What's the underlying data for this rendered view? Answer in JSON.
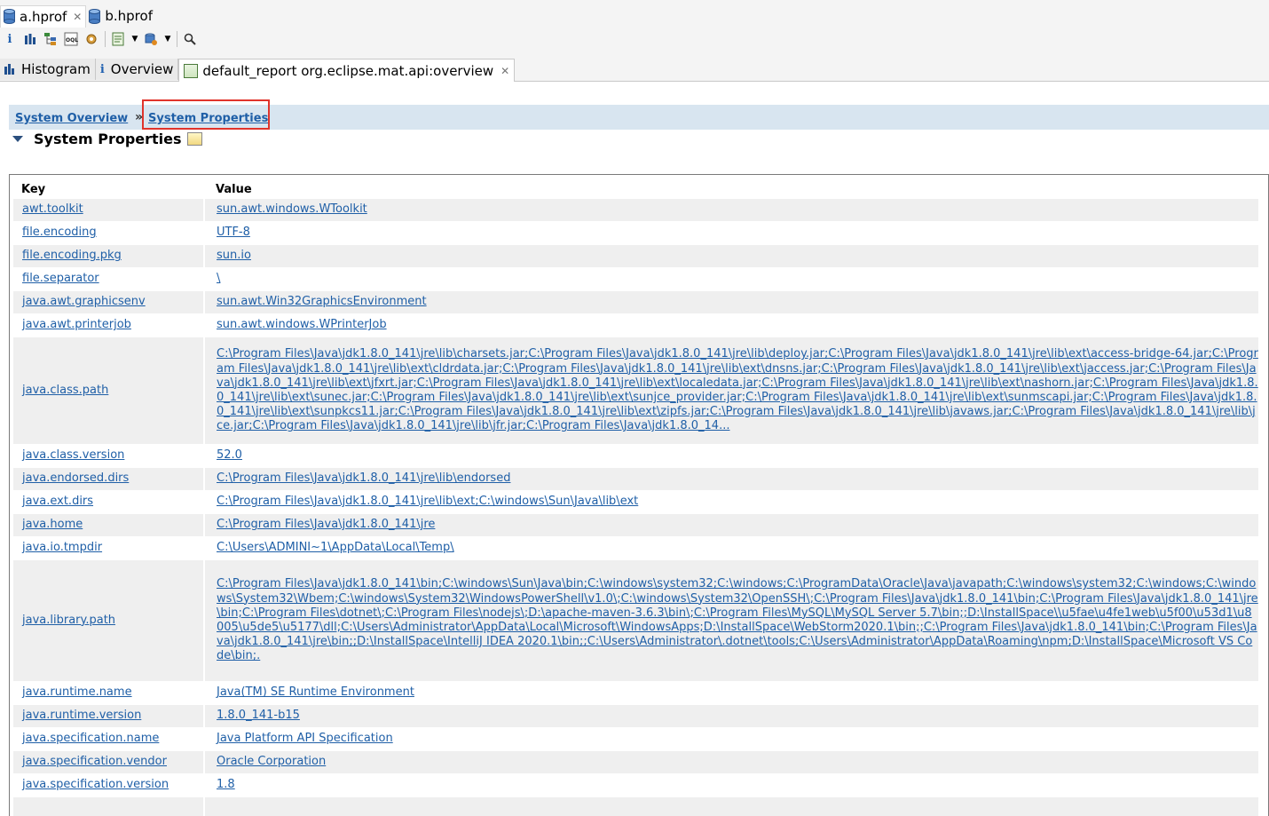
{
  "file_tabs": [
    {
      "label": "a.hprof",
      "icon": "database-icon",
      "active": true
    },
    {
      "label": "b.hprof",
      "icon": "database-icon",
      "active": false
    }
  ],
  "editor_tabs": {
    "histogram": "Histogram",
    "overview": "Overview",
    "report": "default_report  org.eclipse.mat.api:overview"
  },
  "breadcrumb": {
    "first": "System Overview",
    "separator": "»",
    "second": "System Properties"
  },
  "section": {
    "title": "System Properties"
  },
  "table": {
    "key_header": "Key",
    "value_header": "Value",
    "rows": [
      {
        "key": "awt.toolkit",
        "value": "sun.awt.windows.WToolkit"
      },
      {
        "key": "file.encoding",
        "value": "UTF-8"
      },
      {
        "key": "file.encoding.pkg",
        "value": "sun.io"
      },
      {
        "key": "file.separator",
        "value": "\\"
      },
      {
        "key": "java.awt.graphicsenv",
        "value": "sun.awt.Win32GraphicsEnvironment"
      },
      {
        "key": "java.awt.printerjob",
        "value": "sun.awt.windows.WPrinterJob"
      },
      {
        "key": "java.class.path",
        "value": "C:\\Program Files\\Java\\jdk1.8.0_141\\jre\\lib\\charsets.jar;C:\\Program Files\\Java\\jdk1.8.0_141\\jre\\lib\\deploy.jar;C:\\Program Files\\Java\\jdk1.8.0_141\\jre\\lib\\ext\\access-bridge-64.jar;C:\\Program Files\\Java\\jdk1.8.0_141\\jre\\lib\\ext\\cldrdata.jar;C:\\Program Files\\Java\\jdk1.8.0_141\\jre\\lib\\ext\\dnsns.jar;C:\\Program Files\\Java\\jdk1.8.0_141\\jre\\lib\\ext\\jaccess.jar;C:\\Program Files\\Java\\jdk1.8.0_141\\jre\\lib\\ext\\jfxrt.jar;C:\\Program Files\\Java\\jdk1.8.0_141\\jre\\lib\\ext\\localedata.jar;C:\\Program Files\\Java\\jdk1.8.0_141\\jre\\lib\\ext\\nashorn.jar;C:\\Program Files\\Java\\jdk1.8.0_141\\jre\\lib\\ext\\sunec.jar;C:\\Program Files\\Java\\jdk1.8.0_141\\jre\\lib\\ext\\sunjce_provider.jar;C:\\Program Files\\Java\\jdk1.8.0_141\\jre\\lib\\ext\\sunmscapi.jar;C:\\Program Files\\Java\\jdk1.8.0_141\\jre\\lib\\ext\\sunpkcs11.jar;C:\\Program Files\\Java\\jdk1.8.0_141\\jre\\lib\\ext\\zipfs.jar;C:\\Program Files\\Java\\jdk1.8.0_141\\jre\\lib\\javaws.jar;C:\\Program Files\\Java\\jdk1.8.0_141\\jre\\lib\\jce.jar;C:\\Program Files\\Java\\jdk1.8.0_141\\jre\\lib\\jfr.jar;C:\\Program Files\\Java\\jdk1.8.0_14..."
      },
      {
        "key": "java.class.version",
        "value": "52.0"
      },
      {
        "key": "java.endorsed.dirs",
        "value": "C:\\Program Files\\Java\\jdk1.8.0_141\\jre\\lib\\endorsed"
      },
      {
        "key": "java.ext.dirs",
        "value": "C:\\Program Files\\Java\\jdk1.8.0_141\\jre\\lib\\ext;C:\\windows\\Sun\\Java\\lib\\ext"
      },
      {
        "key": "java.home",
        "value": "C:\\Program Files\\Java\\jdk1.8.0_141\\jre"
      },
      {
        "key": "java.io.tmpdir",
        "value": "C:\\Users\\ADMINI~1\\AppData\\Local\\Temp\\"
      },
      {
        "key": "java.library.path",
        "value": "C:\\Program Files\\Java\\jdk1.8.0_141\\bin;C:\\windows\\Sun\\Java\\bin;C:\\windows\\system32;C:\\windows;C:\\ProgramData\\Oracle\\Java\\javapath;C:\\windows\\system32;C:\\windows;C:\\windows\\System32\\Wbem;C:\\windows\\System32\\WindowsPowerShell\\v1.0\\;C:\\windows\\System32\\OpenSSH\\;C:\\Program Files\\Java\\jdk1.8.0_141\\bin;C:\\Program Files\\Java\\jdk1.8.0_141\\jre\\bin;C:\\Program Files\\dotnet\\;C:\\Program Files\\nodejs\\;D:\\apache-maven-3.6.3\\bin\\;C:\\Program Files\\MySQL\\MySQL Server 5.7\\bin;;D:\\InstallSpace\\\\u5fae\\u4fe1web\\u5f00\\u53d1\\u8005\\u5de5\\u5177\\dll;C:\\Users\\Administrator\\AppData\\Local\\Microsoft\\WindowsApps;D:\\InstallSpace\\WebStorm2020.1\\bin;;C:\\Program Files\\Java\\jdk1.8.0_141\\bin;C:\\Program Files\\Java\\jdk1.8.0_141\\jre\\bin;;D:\\InstallSpace\\IntelliJ IDEA 2020.1\\bin;;C:\\Users\\Administrator\\.dotnet\\tools;C:\\Users\\Administrator\\AppData\\Roaming\\npm;D:\\InstallSpace\\Microsoft VS Code\\bin;."
      },
      {
        "key": "java.runtime.name",
        "value": "Java(TM) SE Runtime Environment"
      },
      {
        "key": "java.runtime.version",
        "value": "1.8.0_141-b15"
      },
      {
        "key": "java.specification.name",
        "value": "Java Platform API Specification"
      },
      {
        "key": "java.specification.vendor",
        "value": "Oracle Corporation"
      },
      {
        "key": "java.specification.version",
        "value": "1.8"
      }
    ]
  }
}
